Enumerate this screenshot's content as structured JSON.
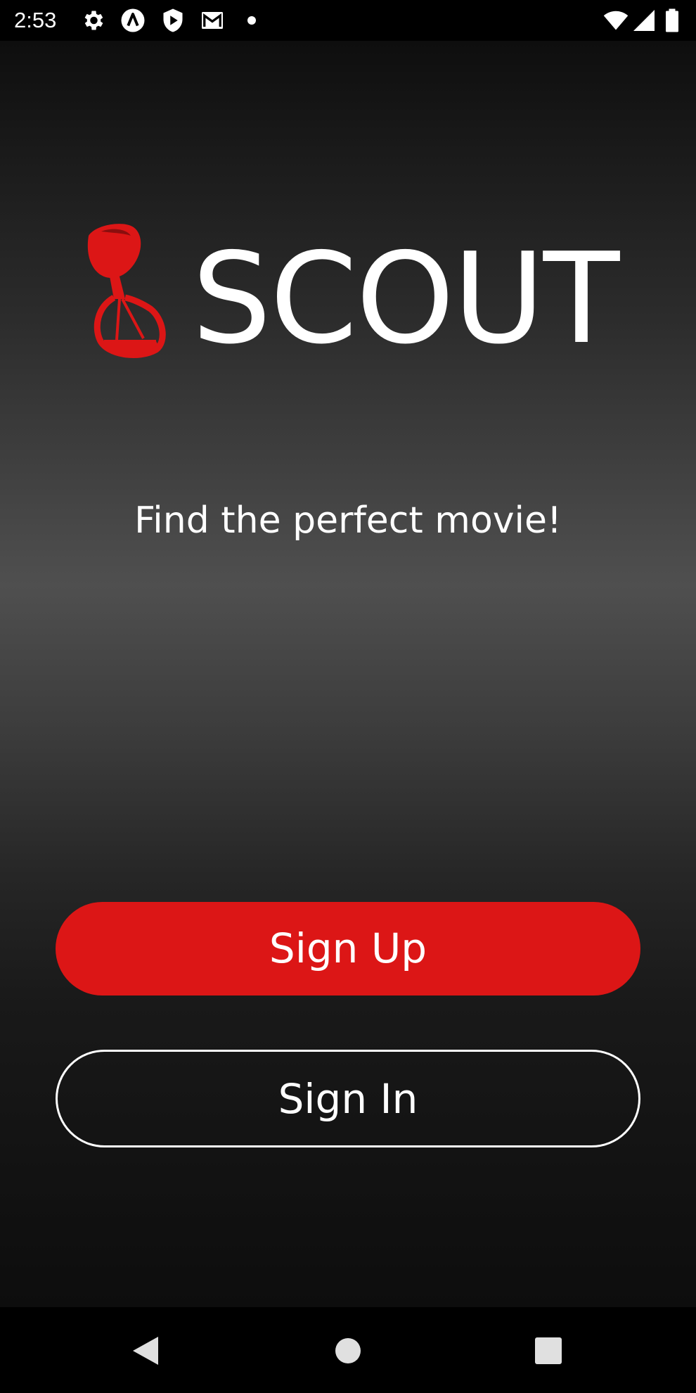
{
  "status_bar": {
    "time": "2:53",
    "left_icons": [
      "gear-icon",
      "app-a-icon",
      "shield-play-icon",
      "gmail-icon",
      "dot-icon"
    ],
    "right_icons": [
      "wifi-icon",
      "signal-icon",
      "battery-icon"
    ]
  },
  "colors": {
    "accent": "#dc1616",
    "text": "#ffffff",
    "background_top": "#0e0e0e",
    "background_mid": "#4f4f4f"
  },
  "logo": {
    "wordmark": "SCOUT"
  },
  "tagline": "Find the perfect movie!",
  "buttons": {
    "sign_up": "Sign Up",
    "sign_in": "Sign In"
  },
  "nav_bar": {
    "icons": [
      "back-icon",
      "home-icon",
      "recents-icon"
    ]
  }
}
